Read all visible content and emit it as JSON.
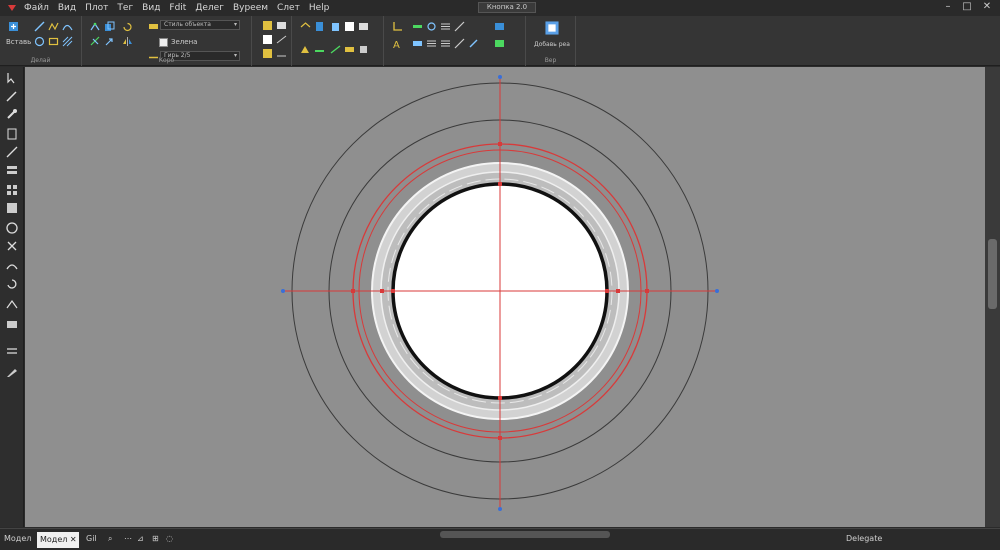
{
  "app": {
    "title": "Кнопка 2.0",
    "menu": [
      "Файл",
      "Вид",
      "Плот",
      "Тег",
      "Вид",
      "Fdit",
      "Делег",
      "Вуреем",
      "Слет",
      "Help"
    ],
    "window_controls": [
      "–",
      "□",
      "✕"
    ]
  },
  "ribbon": {
    "groups": [
      {
        "label": "Делай"
      },
      {
        "label": "Коро"
      },
      {
        "label": ""
      },
      {
        "label": ""
      },
      {
        "label": ""
      },
      {
        "label": "Вер"
      }
    ],
    "texts": {
      "g0_sub": "Вставь",
      "g1_check": "Зелена",
      "right_label": "Добавь реа"
    },
    "dropdowns": [
      {
        "value": "Стиль объекта"
      },
      {
        "value": "Гирь 2/5"
      }
    ]
  },
  "canvas": {
    "background": "#8f8f8f",
    "centerline_color": "#d83a3a",
    "marker_color": "#3a6fd8",
    "ring_color": "#3a3a3a",
    "fill_color": "#ffffff"
  },
  "status": {
    "left": "Модел",
    "model_tab": "Модел",
    "model_tab_x": "✕",
    "coords": "Gil",
    "right": "Delegate"
  }
}
